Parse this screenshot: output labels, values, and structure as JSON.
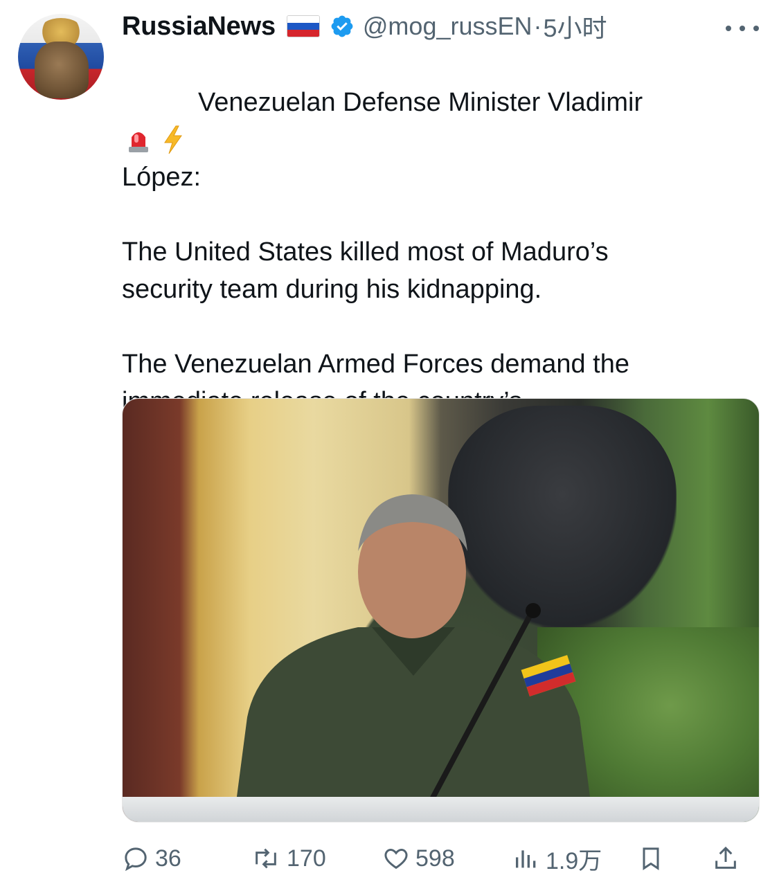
{
  "author": {
    "display_name": "RussiaNews",
    "handle": "@mog_russEN",
    "time": "5小时",
    "separator": "·",
    "flag_icon": "russia-flag-icon",
    "verified_icon": "verified-badge-icon"
  },
  "post": {
    "emoji_1": "police-car-light-icon",
    "emoji_2": "high-voltage-icon",
    "line1": "Venezuelan Defense Minister Vladimir",
    "body": "López:\n\n The United States killed most of Maduro’s\nsecurity team during his kidnapping.\n\n  The Venezuelan Armed Forces demand the\nimmediate release of the country’s\nconstitutional president, Nicolás Maduro.",
    "image_label": "Photo of a man in green military uniform speaking into a microphone"
  },
  "metrics": {
    "replies": "36",
    "reposts": "170",
    "likes": "598",
    "views": "1.9万"
  },
  "colors": {
    "text": "#0f1419",
    "secondary": "#536471",
    "verified": "#1d9bf0"
  }
}
